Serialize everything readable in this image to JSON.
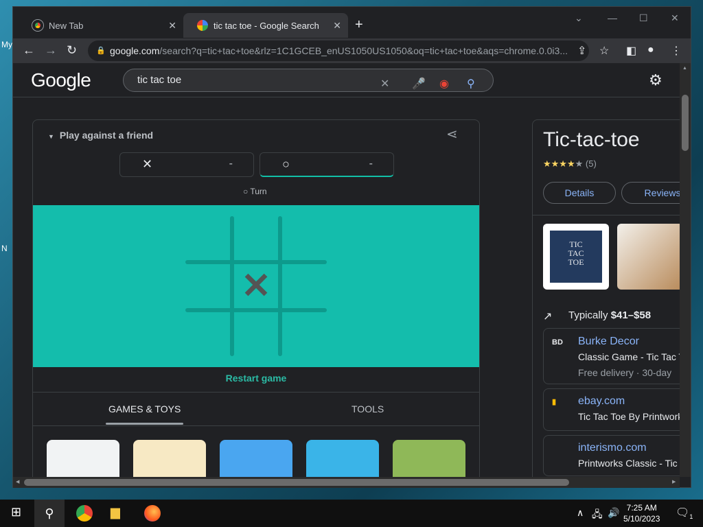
{
  "desktop": {
    "labels": [
      "My",
      "N"
    ]
  },
  "tabs": [
    {
      "title": "New Tab",
      "close": "✕"
    },
    {
      "title": "tic tac toe - Google Search",
      "close": "✕"
    }
  ],
  "new_tab": "+",
  "window_controls": {
    "minimize": "—",
    "maximize": "☐",
    "close": "✕",
    "chevron": "⌄"
  },
  "omnibox": {
    "host": "google.com",
    "path": "/search?q=tic+tac+toe&rlz=1C1GCEB_enUS1050US1050&oq=tic+tac+toe&aqs=chrome.0.0i3..."
  },
  "google": {
    "logo": "Google",
    "query": "tic tac toe"
  },
  "game": {
    "mode": "Play against a friend",
    "players": [
      {
        "symbol": "✕",
        "score": "-"
      },
      {
        "symbol": "○",
        "score": "-"
      }
    ],
    "turn_symbol": "○",
    "turn_label": "Turn",
    "board_mark": "✕",
    "restart": "Restart game",
    "category_tabs": [
      "GAMES & TOYS",
      "TOOLS"
    ]
  },
  "panel": {
    "title": "Tic-tac-toe",
    "stars": "★★★★",
    "star_empty": "★",
    "rating_count": "(5)",
    "buttons": [
      "Details",
      "Reviews"
    ],
    "box_text": [
      "TIC",
      "TAC",
      "TOE"
    ],
    "typical_prefix": "Typically ",
    "typical_price": "$41–$58",
    "stores": [
      {
        "logo": "BD",
        "name": "Burke Decor",
        "desc": "Classic Game - Tic Tac T",
        "delivery": "Free delivery · 30-day"
      },
      {
        "logo": "▮",
        "name": "ebay.com",
        "desc": "Tic Tac Toe By Printwork"
      },
      {
        "logo": "",
        "name": "interismo.com",
        "desc": "Printworks Classic - Tic"
      }
    ]
  },
  "clock": {
    "time": "7:25 AM",
    "date": "5/10/2023"
  },
  "notification_count": "1",
  "colors": {
    "board": "#14bdac",
    "accent": "#8ab4f8",
    "restart": "#2bbba5"
  }
}
